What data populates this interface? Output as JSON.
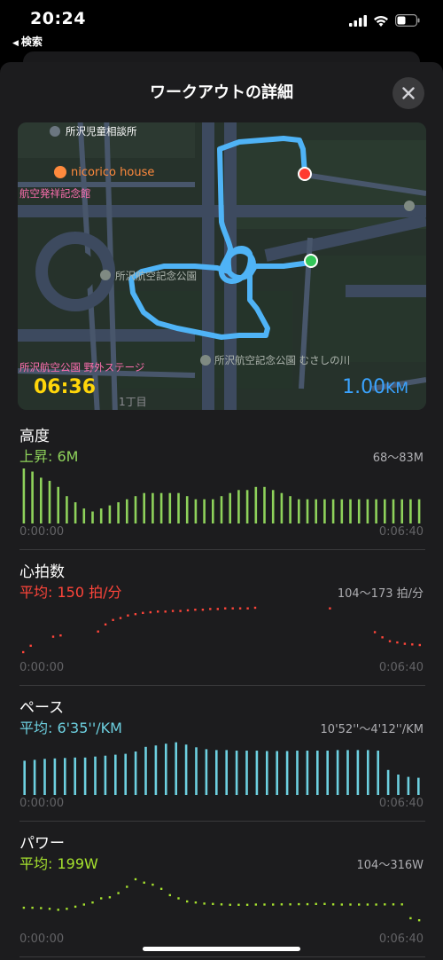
{
  "status_bar": {
    "time": "20:24",
    "back_label": "検索"
  },
  "sheet": {
    "title": "ワークアウトの詳細"
  },
  "map": {
    "labels": [
      {
        "text": "所沢児童相談所",
        "color": "#c7c7cc",
        "icon": "poi-icon"
      },
      {
        "text": "nicorico house",
        "color": "#ff8a3d",
        "icon": "restaurant-icon"
      },
      {
        "text": "航空発祥記念館",
        "color": "#ff6fb0",
        "icon": ""
      },
      {
        "text": "所沢航空記念公園",
        "color": "#aeb5ae",
        "icon": "park-icon"
      },
      {
        "text": "所沢航空公園 野外ステージ",
        "color": "#ff6fb0",
        "icon": ""
      },
      {
        "text": "所沢航空記念公園 むさしの川",
        "color": "#aeb5ae",
        "icon": "park-icon"
      },
      {
        "text": "1丁目",
        "color": "#8e8e93",
        "icon": ""
      }
    ],
    "duration": "06:36",
    "distance_value": "1.00",
    "distance_unit": "KM",
    "route_color": "#4fb3f6"
  },
  "metrics": [
    {
      "title": "高度",
      "summary": "上昇: 6M",
      "range": "68～83M",
      "start": "0:00:00",
      "end": "0:06:40",
      "color": "#8ed25b",
      "min": 68,
      "max": 83,
      "style": "bars",
      "values": [
        83,
        82,
        80,
        79,
        77,
        74,
        72,
        70,
        69,
        70,
        71,
        72,
        73,
        74,
        75,
        75,
        75,
        75,
        75,
        74,
        73,
        73,
        73,
        74,
        75,
        76,
        76,
        77,
        77,
        76,
        75,
        74,
        73,
        73,
        73,
        73,
        73,
        73,
        73,
        73,
        73,
        73,
        73,
        73,
        73,
        73,
        73
      ]
    },
    {
      "title": "心拍数",
      "summary": "平均: 150 拍/分",
      "range": "104～173 拍/分",
      "start": "0:00:00",
      "end": "0:06:40",
      "color": "#ff453a",
      "min": 104,
      "max": 173,
      "style": "dots",
      "values": [
        104,
        114,
        null,
        null,
        128,
        130,
        null,
        null,
        null,
        null,
        136,
        147,
        154,
        157,
        161,
        163,
        165,
        166,
        167,
        167,
        168,
        168,
        169,
        170,
        170,
        171,
        171,
        172,
        172,
        172,
        172,
        173,
        null,
        null,
        null,
        null,
        null,
        null,
        null,
        null,
        null,
        172,
        null,
        null,
        null,
        null,
        null,
        135,
        127,
        121,
        119,
        117,
        116,
        115
      ]
    },
    {
      "title": "ペース",
      "summary": "平均: 6'35''/KM",
      "range": "10'52''～4'12''/KM",
      "start": "0:00:00",
      "end": "0:06:40",
      "color": "#6dd0e0",
      "min": 0,
      "max": 100,
      "style": "bars",
      "values": [
        55,
        57,
        59,
        60,
        61,
        62,
        62,
        64,
        66,
        68,
        70,
        75,
        85,
        88,
        92,
        95,
        90,
        84,
        80,
        78,
        78,
        77,
        77,
        77,
        76,
        76,
        76,
        77,
        77,
        77,
        77,
        78,
        78,
        78,
        78,
        77,
        35,
        25,
        20,
        18
      ]
    },
    {
      "title": "パワー",
      "summary": "平均: 199W",
      "range": "104～316W",
      "start": "0:00:00",
      "end": "0:06:40",
      "color": "#a6e22e",
      "min": 104,
      "max": 316,
      "style": "dots",
      "values": [
        180,
        180,
        178,
        175,
        170,
        175,
        185,
        195,
        205,
        225,
        230,
        250,
        280,
        316,
        300,
        290,
        270,
        240,
        225,
        210,
        205,
        200,
        198,
        196,
        194,
        194,
        194,
        195,
        195,
        195,
        196,
        196,
        197,
        197,
        198,
        198,
        196,
        195,
        195,
        195,
        195,
        195,
        196,
        196,
        196,
        130,
        120
      ]
    }
  ]
}
